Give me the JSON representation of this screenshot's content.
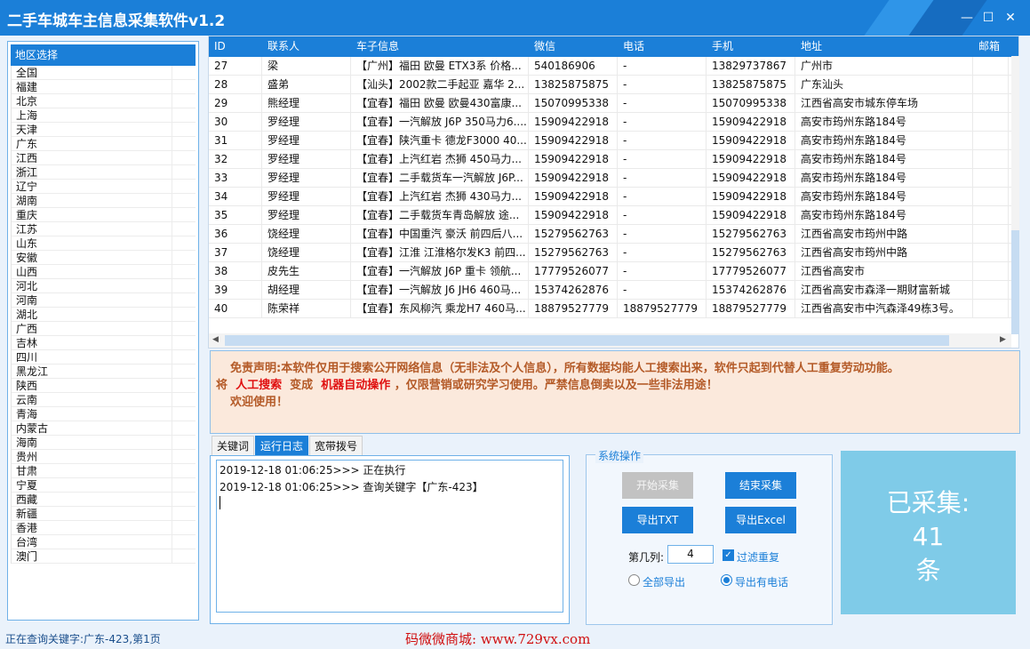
{
  "window": {
    "title": "二手车城车主信息采集软件v1.2",
    "min_icon": "minimize-icon",
    "max_icon": "maximize-icon",
    "close_icon": "close-icon"
  },
  "region": {
    "header": "地区选择",
    "items": [
      "全国",
      "福建",
      "北京",
      "上海",
      "天津",
      "广东",
      "江西",
      "浙江",
      "辽宁",
      "湖南",
      "重庆",
      "江苏",
      "山东",
      "安徽",
      "山西",
      "河北",
      "河南",
      "湖北",
      "广西",
      "吉林",
      "四川",
      "黑龙江",
      "陕西",
      "云南",
      "青海",
      "内蒙古",
      "海南",
      "贵州",
      "甘肃",
      "宁夏",
      "西藏",
      "新疆",
      "香港",
      "台湾",
      "澳门"
    ]
  },
  "grid": {
    "columns": [
      "ID",
      "联系人",
      "车子信息",
      "微信",
      "电话",
      "手机",
      "地址",
      "邮箱"
    ],
    "rows": [
      [
        "27",
        "梁",
        "【广州】福田 欧曼 ETX3系 价格...",
        "540186906",
        "-",
        "13829737867",
        "广州市",
        ""
      ],
      [
        "28",
        "盛弟",
        "【汕头】2002款二手起亚 嘉华 2...",
        "13825875875",
        "-",
        "13825875875",
        "广东汕头",
        ""
      ],
      [
        "29",
        "熊经理",
        "【宜春】福田 欧曼 欧曼430富康...",
        "15070995338",
        "-",
        "15070995338",
        "江西省高安市城东停车场",
        ""
      ],
      [
        "30",
        "罗经理",
        "【宜春】一汽解放 J6P 350马力6....",
        "15909422918",
        "-",
        "15909422918",
        "高安市筠州东路184号",
        ""
      ],
      [
        "31",
        "罗经理",
        "【宜春】陕汽重卡 德龙F3000 40...",
        "15909422918",
        "-",
        "15909422918",
        "高安市筠州东路184号",
        ""
      ],
      [
        "32",
        "罗经理",
        "【宜春】上汽红岩 杰狮 450马力...",
        "15909422918",
        "-",
        "15909422918",
        "高安市筠州东路184号",
        ""
      ],
      [
        "33",
        "罗经理",
        "【宜春】二手载货车一汽解放 J6P...",
        "15909422918",
        "-",
        "15909422918",
        "高安市筠州东路184号",
        ""
      ],
      [
        "34",
        "罗经理",
        "【宜春】上汽红岩 杰狮 430马力...",
        "15909422918",
        "-",
        "15909422918",
        "高安市筠州东路184号",
        ""
      ],
      [
        "35",
        "罗经理",
        "【宜春】二手载货车青岛解放 途...",
        "15909422918",
        "-",
        "15909422918",
        "高安市筠州东路184号",
        ""
      ],
      [
        "36",
        "饶经理",
        "【宜春】中国重汽 豪沃 前四后八...",
        "15279562763",
        "-",
        "15279562763",
        "江西省高安市筠州中路",
        ""
      ],
      [
        "37",
        "饶经理",
        "【宜春】江淮 江淮格尔发K3 前四...",
        "15279562763",
        "-",
        "15279562763",
        "江西省高安市筠州中路",
        ""
      ],
      [
        "38",
        "皮先生",
        "【宜春】一汽解放 J6P 重卡 领航...",
        "17779526077",
        "-",
        "17779526077",
        "江西省高安市",
        ""
      ],
      [
        "39",
        "胡经理",
        "【宜春】一汽解放 J6 JH6 460马...",
        "15374262876",
        "-",
        "15374262876",
        "江西省高安市森泽一期财富新城",
        ""
      ],
      [
        "40",
        "陈荣祥",
        "【宜春】东风柳汽 乘龙H7 460马...",
        "18879527779",
        "18879527779",
        "18879527779",
        "江西省高安市中汽森泽49栋3号。",
        ""
      ]
    ]
  },
  "disclaimer": {
    "line1": "免责声明:本软件仅用于搜索公开网络信息（无非法及个人信息），所有数据均能人工搜索出来，软件只起到代替人工重复劳动功能。",
    "line2_prefix": "将",
    "manual": "人工搜索",
    "change": "变成",
    "auto": "机器自动操作",
    "line2_suffix": "，仅限营销或研究学习使用。严禁信息倒卖以及一些非法用途！",
    "line3": "欢迎使用！"
  },
  "tabs": [
    "关键词",
    "运行日志",
    "宽带拨号"
  ],
  "log": {
    "lines": [
      "2019-12-18 01:06:25>>> 正在执行",
      "2019-12-18 01:06:25>>> 查询关键字【广东-423】"
    ]
  },
  "ops": {
    "legend": "系统操作",
    "start": "开始采集",
    "stop": "结束采集",
    "export_txt": "导出TXT",
    "export_excel": "导出Excel",
    "column_label": "第几列:",
    "column_value": "4",
    "filter_label": "过滤重复",
    "filter_checked": true,
    "export_all": "全部导出",
    "export_phone": "导出有电话",
    "selected_export": "导出有电话"
  },
  "counter": {
    "label": "已采集:",
    "value": "41",
    "unit": "条"
  },
  "status": {
    "text": "正在查询关键字:广东-423,第1页",
    "watermark": "码微微商城: www.729vx.com"
  },
  "colors": {
    "accent": "#1b7fd8",
    "disclaimer_bg": "#fbe9dc",
    "counter_bg": "#7fcbe8",
    "highlight_red": "#e01010"
  }
}
